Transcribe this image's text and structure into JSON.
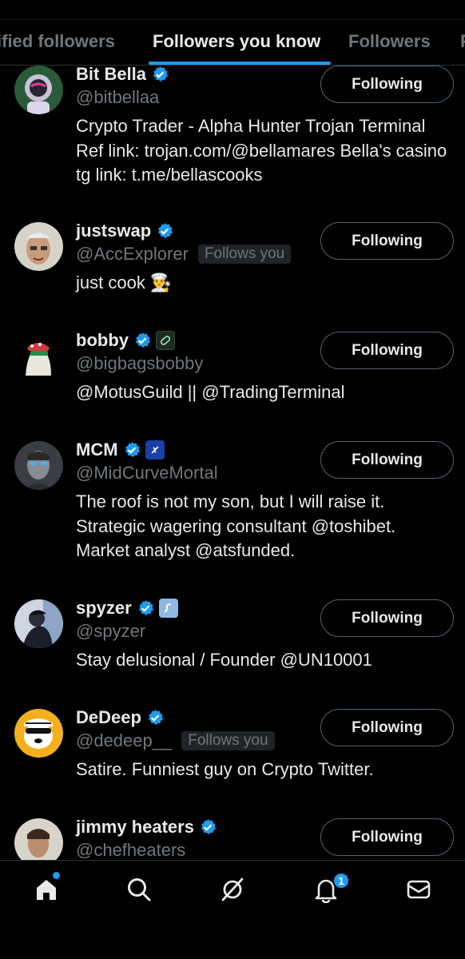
{
  "tabs": {
    "items": [
      {
        "label": "ified followers"
      },
      {
        "label": "Followers you know"
      },
      {
        "label": "Followers"
      }
    ],
    "active": "Followers you know"
  },
  "users": [
    {
      "name": "Bit Bella",
      "handle": "@bitbellaa",
      "follows_you": "",
      "bio": "Crypto Trader - Alpha Hunter Trojan Terminal Ref link: trojan.com/@bellamares Bella's casino tg link: t.me/bellascooks",
      "button": "Following",
      "affiliate_badge": ""
    },
    {
      "name": "justswap",
      "handle": "@AccExplorer",
      "follows_you": "Follows you",
      "bio": "just cook 👨‍🍳",
      "button": "Following",
      "affiliate_badge": ""
    },
    {
      "name": "bobby",
      "handle": "@bigbagsbobby",
      "follows_you": "",
      "bio": "@MotusGuild || @TradingTerminal",
      "button": "Following",
      "affiliate_badge": "pill-badge-icon"
    },
    {
      "name": "MCM",
      "handle": "@MidCurveMortal",
      "follows_you": "",
      "bio": "The roof is not my son, but I will raise it. Strategic wagering consultant @toshibet. Market analyst @atsfunded.",
      "button": "Following",
      "affiliate_badge": "toshibet-badge-icon"
    },
    {
      "name": "spyzer",
      "handle": "@spyzer",
      "follows_you": "",
      "bio": "Stay delusional / Founder @UN10001",
      "button": "Following",
      "affiliate_badge": "un-badge-icon"
    },
    {
      "name": "DeDeep",
      "handle": "@dedeep__",
      "follows_you": "Follows you",
      "bio": "Satire. Funniest guy on Crypto Twitter.",
      "button": "Following",
      "affiliate_badge": ""
    },
    {
      "name": "jimmy heaters",
      "handle": "@chefheaters",
      "follows_you": "",
      "bio": "",
      "button": "Following",
      "affiliate_badge": ""
    }
  ],
  "bottom_nav": {
    "items": [
      "home-icon",
      "search-icon",
      "grok-icon",
      "notifications-icon",
      "messages-icon"
    ],
    "notification_count": "1"
  },
  "colors": {
    "accent": "#1d9bf0",
    "background": "#000000",
    "text_primary": "#e7e9ea",
    "text_secondary": "#71767b"
  }
}
